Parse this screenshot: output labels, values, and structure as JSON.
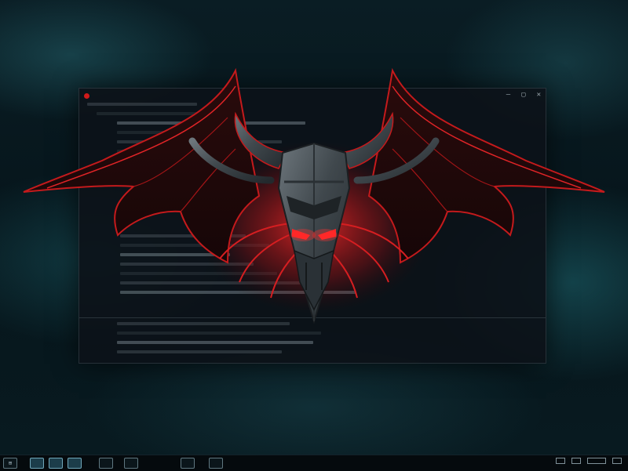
{
  "window": {
    "controls": {
      "minimize": "—",
      "maximize": "▢",
      "close": "✕"
    }
  },
  "taskbar": {
    "buttons": [
      {
        "name": "start",
        "active": false
      },
      {
        "name": "app-1",
        "active": true
      },
      {
        "name": "app-2",
        "active": true
      },
      {
        "name": "app-3",
        "active": true
      },
      {
        "name": "app-4",
        "active": false
      },
      {
        "name": "app-5",
        "active": false
      },
      {
        "name": "app-6",
        "active": false
      },
      {
        "name": "app-7",
        "active": false
      }
    ]
  },
  "colors": {
    "accent_red": "#d01a1a",
    "emblem_metal": "#4d565c",
    "background_teal": "#0a1d24"
  },
  "icons": {
    "emblem": "winged-horned-mask-emblem",
    "close": "close-icon",
    "minimize": "minimize-icon",
    "maximize": "maximize-icon"
  }
}
